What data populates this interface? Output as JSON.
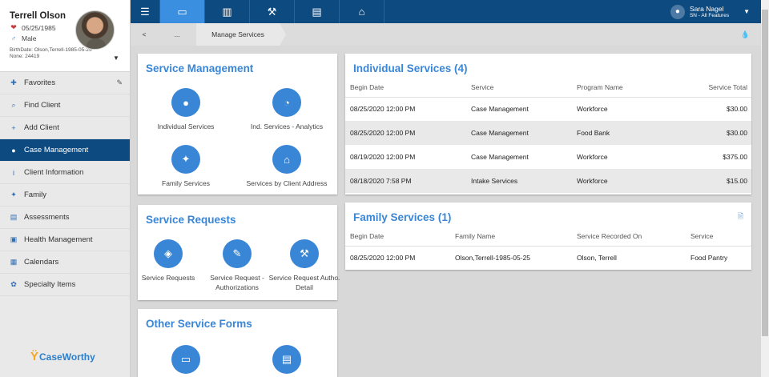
{
  "client": {
    "name": "Terrell Olson",
    "dob": "05/25/1985",
    "gender": "Male",
    "birthdate_line": "BirthDate: Olson,Terrell-1985-05-25",
    "none_line": "None: 24419"
  },
  "sidebar": {
    "items": [
      {
        "label": "Favorites",
        "icon": "pin-icon"
      },
      {
        "label": "Find Client",
        "icon": "search-icon"
      },
      {
        "label": "Add Client",
        "icon": "plus-icon"
      },
      {
        "label": "Case Management",
        "icon": "person-icon"
      },
      {
        "label": "Client Information",
        "icon": "info-icon"
      },
      {
        "label": "Family",
        "icon": "family-icon"
      },
      {
        "label": "Assessments",
        "icon": "assessments-icon"
      },
      {
        "label": "Health Management",
        "icon": "health-icon"
      },
      {
        "label": "Calendars",
        "icon": "calendar-icon"
      },
      {
        "label": "Specialty Items",
        "icon": "specialty-icon"
      }
    ],
    "logo": "CaseWorthy"
  },
  "topbar": {
    "user_name": "Sara Nagel",
    "user_role": "SN - All Features"
  },
  "breadcrumb": {
    "back": "<",
    "ellipsis": "...",
    "current": "Manage Services"
  },
  "service_management": {
    "title": "Service Management",
    "tiles": [
      "Individual Services",
      "Ind. Services - Analytics",
      "Family Services",
      "Services by Client Address"
    ]
  },
  "service_requests": {
    "title": "Service Requests",
    "tiles": [
      "Service Requests",
      "Service Request - Authorizations",
      "Service Request Autho. Detail"
    ]
  },
  "other_forms": {
    "title": "Other Service Forms"
  },
  "individual_services": {
    "title": "Individual Services (4)",
    "columns": [
      "Begin Date",
      "Service",
      "Program Name",
      "Service Total"
    ],
    "rows": [
      [
        "08/25/2020 12:00 PM",
        "Case Management",
        "Workforce",
        "$30.00"
      ],
      [
        "08/25/2020 12:00 PM",
        "Case Management",
        "Food Bank",
        "$30.00"
      ],
      [
        "08/19/2020 12:00 PM",
        "Case Management",
        "Workforce",
        "$375.00"
      ],
      [
        "08/18/2020 7:58 PM",
        "Intake Services",
        "Workforce",
        "$15.00"
      ]
    ]
  },
  "family_services": {
    "title": "Family Services (1)",
    "columns": [
      "Begin Date",
      "Family Name",
      "Service Recorded On",
      "Service"
    ],
    "rows": [
      [
        "08/25/2020 12:00 PM",
        "Olson,Terrell-1985-05-25",
        "Olson, Terrell",
        "Food Pantry"
      ]
    ]
  },
  "colors": {
    "nav_dark": "#0d4a80",
    "accent": "#3a86d6",
    "active_tab": "#3a8fe0"
  }
}
